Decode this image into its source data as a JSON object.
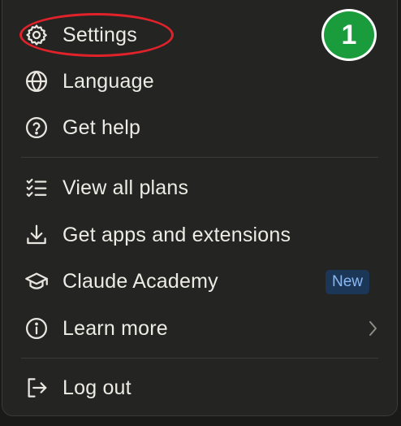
{
  "menu": {
    "items": [
      {
        "label": "Settings",
        "icon": "gear-icon"
      },
      {
        "label": "Language",
        "icon": "globe-icon"
      },
      {
        "label": "Get help",
        "icon": "help-circle-icon"
      },
      {
        "label": "View all plans",
        "icon": "checklist-icon"
      },
      {
        "label": "Get apps and extensions",
        "icon": "download-icon"
      },
      {
        "label": "Claude Academy",
        "icon": "graduation-cap-icon",
        "badge": "New"
      },
      {
        "label": "Learn more",
        "icon": "info-circle-icon",
        "chevron": "chevron-right-icon"
      },
      {
        "label": "Log out",
        "icon": "log-out-icon"
      }
    ]
  },
  "annotation": {
    "step_number": "1",
    "highlight_color": "#e0222a",
    "step_color": "#1a9c3c"
  },
  "colors": {
    "menu_background": "#242423",
    "text": "#ecebe4",
    "badge_background": "#1c3658",
    "badge_text": "#8ab8f2"
  }
}
